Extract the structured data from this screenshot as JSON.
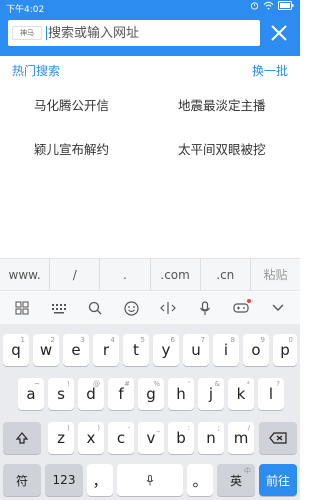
{
  "status": {
    "time": "下午4:02"
  },
  "search": {
    "engine": "神马",
    "placeholder": "搜索或输入网址"
  },
  "hot": {
    "title": "热门搜索",
    "refresh": "换一批",
    "items": [
      "马化腾公开信",
      "地震最淡定主播",
      "颖儿宣布解约",
      "太平间双眼被挖"
    ]
  },
  "quickbar": [
    "www.",
    "/",
    ".",
    ".com",
    ".cn",
    "粘贴"
  ],
  "toolbar_icons": [
    "grid-icon",
    "keyboard-icon",
    "search-icon",
    "emoji-icon",
    "cursor-icon",
    "mic-icon",
    "game-icon",
    "collapse-icon"
  ],
  "keyboard": {
    "row1": [
      "q",
      "w",
      "e",
      "r",
      "t",
      "y",
      "u",
      "i",
      "o",
      "p"
    ],
    "row1_sub": [
      "1",
      "2",
      "3",
      "4",
      "5",
      "6",
      "7",
      "8",
      "9",
      "0"
    ],
    "row2": [
      "a",
      "s",
      "d",
      "f",
      "g",
      "h",
      "j",
      "k",
      "l"
    ],
    "row2_sub": [
      "~",
      "!",
      "@",
      "#",
      "%",
      "'",
      "&",
      "*",
      "?"
    ],
    "row3": [
      "z",
      "x",
      "c",
      "v",
      "b",
      "n",
      "m"
    ],
    "row3_sub": [
      "(",
      ")",
      "-",
      "_",
      ":",
      ";",
      "/"
    ],
    "symbol": "符",
    "numbers": "123",
    "comma": "，",
    "space_mic": "mic",
    "period": "。",
    "lang": "英",
    "lang_sub": "中",
    "go": "前往"
  },
  "colors": {
    "accent": "#2d8cf0"
  }
}
